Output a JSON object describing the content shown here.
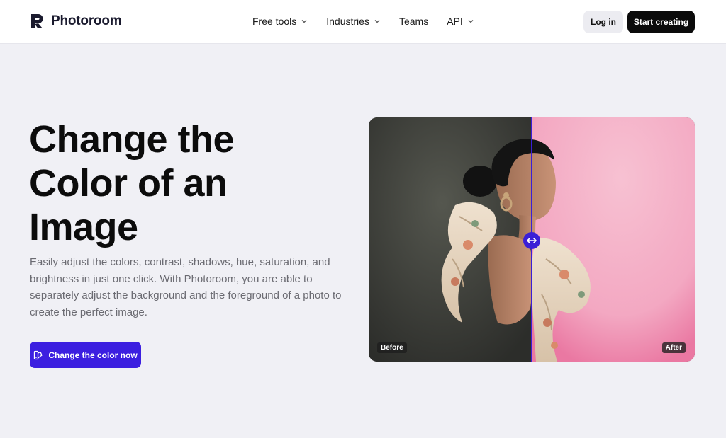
{
  "brand": {
    "name": "Photoroom",
    "accent": "#3c1fe0"
  },
  "nav": {
    "items": [
      {
        "label": "Free tools",
        "has_dropdown": true
      },
      {
        "label": "Industries",
        "has_dropdown": true
      },
      {
        "label": "Teams",
        "has_dropdown": false
      },
      {
        "label": "API",
        "has_dropdown": true
      }
    ],
    "login_label": "Log in",
    "start_label": "Start creating"
  },
  "hero": {
    "title": "Change the Color of an Image",
    "description": "Easily adjust the colors, contrast, shadows, hue, saturation, and brightness in just one click. With Photoroom, you are able to separately adjust the background and the foreground of a photo to create the perfect image.",
    "cta_label": "Change the color now"
  },
  "comparison": {
    "before_label": "Before",
    "after_label": "After",
    "before_bg": "#3d3e3a",
    "after_bg": "#f2a4bf",
    "handle_icon": "arrows-left-right-icon"
  }
}
